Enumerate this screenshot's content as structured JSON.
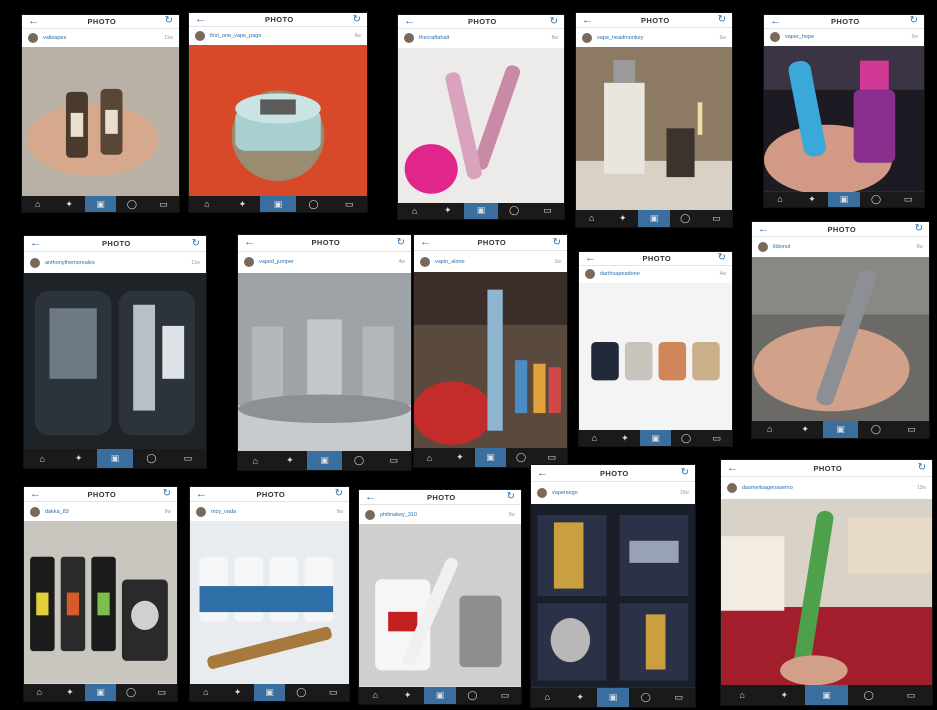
{
  "screen_title": "PHOTO",
  "nav_icons": [
    "home-icon",
    "explore-icon",
    "camera-icon",
    "activity-icon",
    "profile-icon"
  ],
  "cards": [
    {
      "username": "vaitsapes",
      "age": "11w"
    },
    {
      "username": "first_one_vape_page",
      "age": "9w"
    },
    {
      "username": "thecraftahalt",
      "age": "8w"
    },
    {
      "username": "vape_headmonkey",
      "age": "6w"
    },
    {
      "username": "vaper_hope",
      "age": "5w"
    },
    {
      "username": "anthonythemorealex",
      "age": "11w"
    },
    {
      "username": "vaped_jumper",
      "age": "4w"
    },
    {
      "username": "vapin_alone",
      "age": "3w"
    },
    {
      "username": "darthvapeadone",
      "age": "4w"
    },
    {
      "username": "lildonut",
      "age": "8w"
    },
    {
      "username": "dakka_83",
      "age": "9w"
    },
    {
      "username": "mzy_vada",
      "age": "9w"
    },
    {
      "username": "philmakey_310",
      "age": "9w"
    },
    {
      "username": "vapersego",
      "age": "10w"
    },
    {
      "username": "dasmeitsagenasemo",
      "age": "13w"
    }
  ]
}
